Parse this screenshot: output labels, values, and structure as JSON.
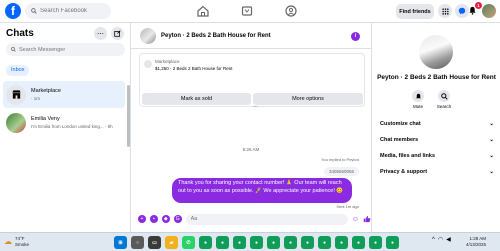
{
  "topbar": {
    "logo": "f",
    "search_placeholder": "Search Facebook",
    "find_friends": "Find friends",
    "notif_count": "1"
  },
  "left": {
    "title": "Chats",
    "search_placeholder": "Search Messenger",
    "inbox_tab": "Inbox",
    "conversations": [
      {
        "name": "Marketplace",
        "sub": "· 1m"
      },
      {
        "name": "Emilia Veny",
        "sub": "I'm Emilia from London united king... · 9h"
      }
    ]
  },
  "chat": {
    "title": "Peyton · 2 Beds 2 Bath House for Rent",
    "marketplace_label": "Marketplace",
    "listing": "$1,250 · 2 Beds 2 Bath House for Rent",
    "mark_sold": "Mark as sold",
    "more_options": "More options",
    "dots": "...",
    "timestamp": "5:26 AM",
    "replied": "You replied to Peyton",
    "phone": "3405560066",
    "message": "Thank you for sharing your contact number! 🙏 Our team will reach out to you as soon as possible. 🚀 We appreciate your patience! 😊",
    "sent": "Sent 1m ago",
    "composer_placeholder": "Aa"
  },
  "right": {
    "title": "Peyton · 2 Beds 2 Bath House for Rent",
    "mute": "Mute",
    "search": "Search",
    "sections": [
      "Customize chat",
      "Chat members",
      "Media, files and links",
      "Privacy & support"
    ]
  },
  "taskbar": {
    "temp": "74°F",
    "weather": "Smoke",
    "time": "1:28 AM",
    "date": "4/13/2025"
  },
  "colors": {
    "accent": "#8a2be2",
    "facebook_blue": "#0866ff"
  }
}
